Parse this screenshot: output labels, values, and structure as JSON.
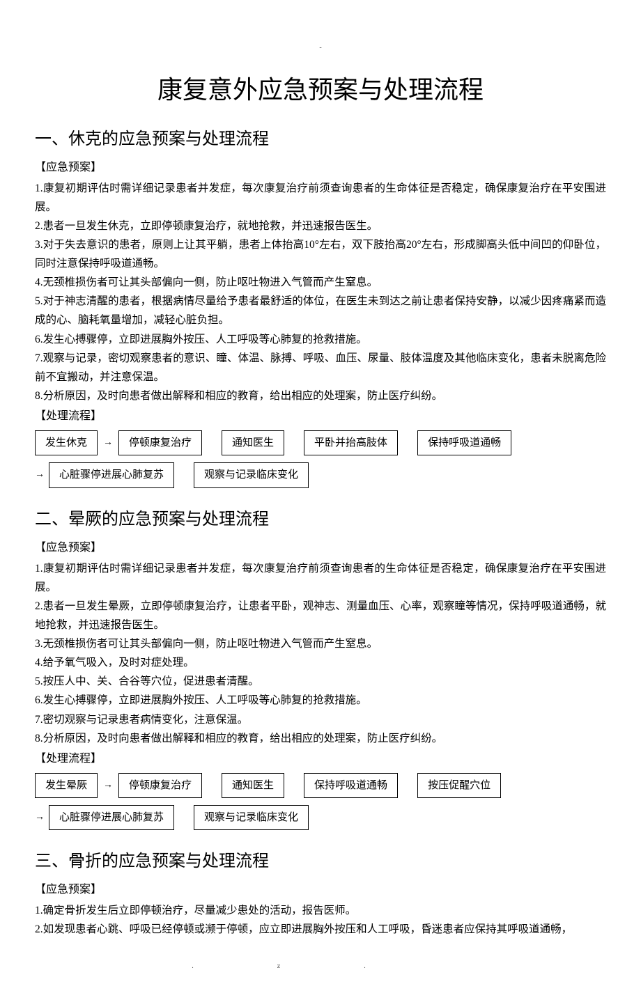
{
  "marks": {
    "top": "-",
    "bottom_left": ".",
    "bottom_right": "z."
  },
  "title": "康复意外应急预案与处理流程",
  "sections": [
    {
      "heading": "一、休克的应急预案与处理流程",
      "plan_label": "【应急预案】",
      "plan_items": [
        "1.康复初期评估时需详细记录患者并发症，每次康复治疗前须查询患者的生命体征是否稳定，确保康复治疗在平安围进展。",
        "2.患者一旦发生休克，立即停顿康复治疗，就地抢救，并迅速报告医生。",
        "3.对于失去意识的患者，原则上让其平躺，患者上体抬高10°左右，双下肢抬高20°左右，形成脚高头低中间凹的仰卧位，同时注意保持呼吸道通畅。",
        "4.无颈椎损伤者可让其头部偏向一侧，防止呕吐物进入气管而产生窒息。",
        "5.对于神志清醒的患者，根据病情尽量给予患者最舒适的体位，在医生未到达之前让患者保持安静，以减少因疼痛紧而造成的心、脑耗氧量增加，减轻心脏负担。",
        "6.发生心搏骤停，立即进展胸外按压、人工呼吸等心肺复的抢救措施。",
        "7.观察与记录，密切观察患者的意识、瞳、体温、脉搏、呼吸、血压、尿量、肢体温度及其他临床变化，患者未脱离危险前不宜搬动，并注意保温。",
        "8.分析原因，及时向患者做出解释和相应的教育，给出相应的处理案，防止医疗纠纷。"
      ],
      "flow_label": "【处理流程】",
      "flow_row1": [
        "发生休克",
        "停顿康复治疗",
        "通知医生",
        "平卧并抬高肢体",
        "保持呼吸道通畅"
      ],
      "flow_row2": [
        "心脏骤停进展心肺复苏",
        "观察与记录临床变化"
      ]
    },
    {
      "heading": "二、晕厥的应急预案与处理流程",
      "plan_label": "【应急预案】",
      "plan_items": [
        "1.康复初期评估时需详细记录患者并发症，每次康复治疗前须查询患者的生命体征是否稳定，确保康复治疗在平安围进展。",
        "2.患者一旦发生晕厥，立即停顿康复治疗，让患者平卧，观神志、测量血压、心率，观察瞳等情况，保持呼吸道通畅，就地抢救，并迅速报告医生。",
        "3.无颈椎损伤者可让其头部偏向一侧，防止呕吐物进入气管而产生窒息。",
        "4.给予氧气吸入，及时对症处理。",
        "5.按压人中、关、合谷等穴位，促进患者清醒。",
        "6.发生心搏骤停，立即进展胸外按压、人工呼吸等心肺复的抢救措施。",
        "7.密切观察与记录患者病情变化，注意保温。",
        "8.分析原因，及时向患者做出解释和相应的教育，给出相应的处理案，防止医疗纠纷。"
      ],
      "flow_label": "【处理流程】",
      "flow_row1": [
        "发生晕厥",
        "停顿康复治疗",
        "通知医生",
        "保持呼吸道通畅",
        "按压促醒穴位"
      ],
      "flow_row2": [
        "心脏骤停进展心肺复苏",
        "观察与记录临床变化"
      ]
    },
    {
      "heading": "三、骨折的应急预案与处理流程",
      "plan_label": "【应急预案】",
      "plan_items": [
        "1.确定骨折发生后立即停顿治疗，尽量减少患处的活动，报告医师。",
        "2.如发现患者心跳、呼吸已经停顿或濒于停顿，应立即进展胸外按压和人工呼吸，昏迷患者应保持其呼吸道通畅，"
      ]
    }
  ]
}
